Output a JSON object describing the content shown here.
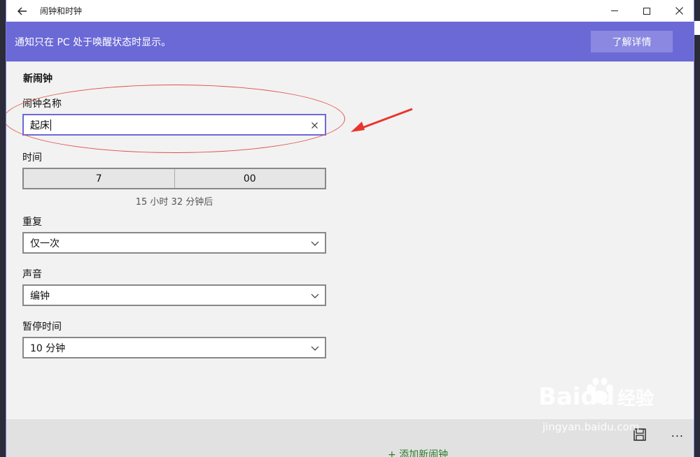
{
  "window": {
    "title": "闹钟和时钟",
    "back_icon": "back-arrow-icon",
    "controls": [
      "minimize",
      "maximize",
      "close"
    ]
  },
  "notification": {
    "text": "通知只在 PC 处于唤醒状态时显示。",
    "button_label": "了解详情",
    "color": "#6b69d6"
  },
  "form": {
    "section_title": "新闹钟",
    "name_label": "闹钟名称",
    "name_value": "起床",
    "time_label": "时间",
    "hour": "7",
    "minute": "00",
    "time_note": "15 小时 32 分钟后",
    "repeat_label": "重复",
    "repeat_value": "仅一次",
    "sound_label": "声音",
    "sound_value": "编钟",
    "snooze_label": "暂停时间",
    "snooze_value": "10 分钟"
  },
  "bottom": {
    "more_label": "...",
    "below_text": "+ 添加新闹钟"
  },
  "watermark": {
    "logo": "Bai",
    "logo_tail": "du",
    "logo_cn": "经验",
    "sub": "jingyan.baidu.com"
  }
}
